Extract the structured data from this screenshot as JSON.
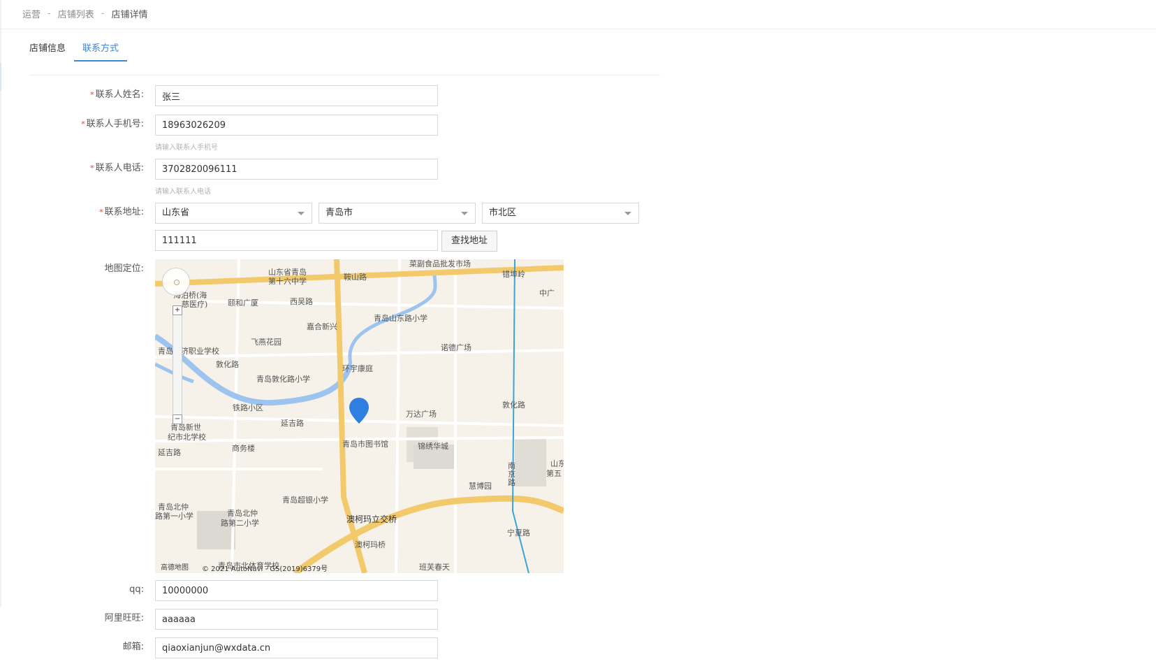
{
  "breadcrumb": {
    "items": [
      "运营",
      "店铺列表",
      "店铺详情"
    ]
  },
  "tabs": [
    {
      "label": "店铺信息",
      "active": false
    },
    {
      "label": "联系方式",
      "active": true
    }
  ],
  "form": {
    "contact_name": {
      "label": "联系人姓名:",
      "value": "张三"
    },
    "mobile": {
      "label": "联系人手机号:",
      "value": "18963026209",
      "hint": "请输入联系人手机号"
    },
    "phone": {
      "label": "联系人电话:",
      "value": "3702820096111",
      "hint": "请输入联系人电话"
    },
    "address": {
      "label": "联系地址:",
      "province": "山东省",
      "city": "青岛市",
      "district": "市北区",
      "detail": "111111",
      "search_button": "查找地址"
    },
    "map": {
      "label": "地图定位:",
      "logo": "高德地图",
      "attribution": "© 2021 AutoNavi - GS(2019)6379号",
      "places": {
        "p1": "山东省青岛",
        "p2": "第十六中学",
        "p3": "菜副食品批发市场",
        "p4": "错埠岭",
        "p5": "中广",
        "p6": "鞍山路",
        "p7": "海泊桥(海",
        "p8": "慈医疗)",
        "p9": "颐和广厦",
        "p10": "西吴路",
        "p11": "嘉合新兴",
        "p12": "青岛山东路小学",
        "p13": "飞燕花园",
        "p14": "诺德广场",
        "p15": "青岛经济职业学校",
        "p16": "敦化路",
        "p17": "环宇康庭",
        "p18": "青岛敦化路小学",
        "p19": "敦化路",
        "p20": "铁路小区",
        "p21": "万达广场",
        "p22": "延吉路",
        "p23": "青岛新世",
        "p24": "纪市北学校",
        "p25": "商务楼",
        "p26": "青岛市图书馆",
        "p27": "锦绣华城",
        "p28": "延吉路",
        "p29": "南京路",
        "p30": "山东",
        "p31": "第五",
        "p32": "慧博园",
        "p33": "青岛北仲",
        "p34": "路第一小学",
        "p35": "青岛北仲",
        "p36": "路第二小学",
        "p37": "青岛超银小学",
        "p38": "澳柯玛立交桥",
        "p39": "宁夏路",
        "p40": "澳柯玛桥",
        "p41": "青岛市北体育学校",
        "p42": "班芙春天"
      }
    },
    "qq": {
      "label": "qq:",
      "value": "10000000"
    },
    "wangwang": {
      "label": "阿里旺旺:",
      "value": "aaaaaa"
    },
    "email": {
      "label": "邮箱:",
      "value": "qiaoxianjun@wxdata.cn"
    }
  },
  "colors": {
    "accent": "#3e86d6",
    "required": "#e0463b"
  }
}
